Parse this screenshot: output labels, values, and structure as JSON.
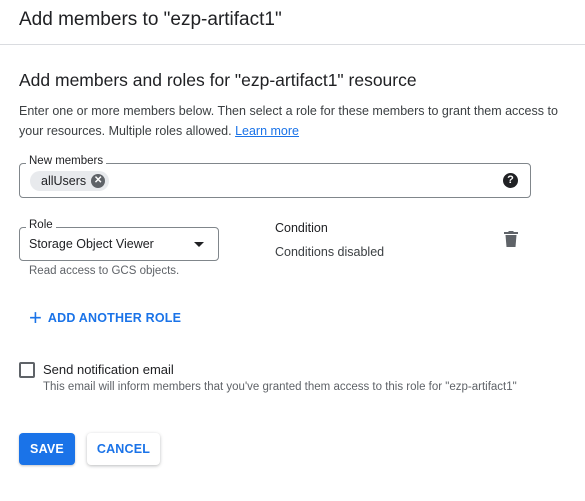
{
  "dialog": {
    "title": "Add members to \"ezp-artifact1\""
  },
  "section": {
    "title": "Add members and roles for \"ezp-artifact1\" resource",
    "description": "Enter one or more members below. Then select a role for these members to grant them access to your resources. Multiple roles allowed.",
    "learn_more": "Learn more"
  },
  "members": {
    "label": "New members",
    "chips": [
      "allUsers"
    ],
    "help_icon": "help-icon"
  },
  "role": {
    "label": "Role",
    "value": "Storage Object Viewer",
    "hint": "Read access to GCS objects."
  },
  "condition": {
    "title": "Condition",
    "value": "Conditions disabled",
    "delete_icon": "trash-icon"
  },
  "add_role": {
    "label": "ADD ANOTHER ROLE"
  },
  "notification": {
    "label": "Send notification email",
    "hint": "This email will inform members that you've granted them access to this role for \"ezp-artifact1\"",
    "checked": false
  },
  "actions": {
    "save": "SAVE",
    "cancel": "CANCEL"
  },
  "colors": {
    "accent": "#1a73e8",
    "border": "#80868b",
    "chip_bg": "#e8eaed"
  }
}
